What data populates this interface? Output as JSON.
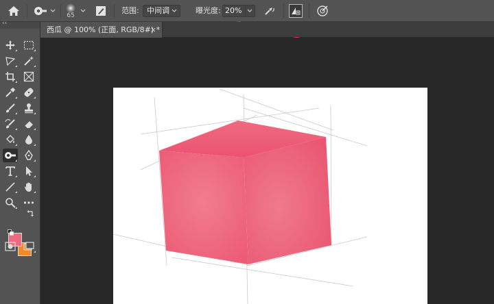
{
  "options_bar": {
    "brush_size": "65",
    "range_label": "范围:",
    "range_value": "中间调",
    "exposure_label": "曝光度:",
    "exposure_value": "20%"
  },
  "document_tab": {
    "title": "西瓜 @ 100% (正面, RGB/8#) *",
    "close_label": "×"
  },
  "toolbar": {
    "collapse_label": "‹‹",
    "active_tool": "dodge-tool"
  },
  "colors": {
    "foreground": "#ef6a7e",
    "background": "#ef8a2a",
    "cube": "#ee5f78",
    "annotation_arrow": "#e8343a"
  }
}
